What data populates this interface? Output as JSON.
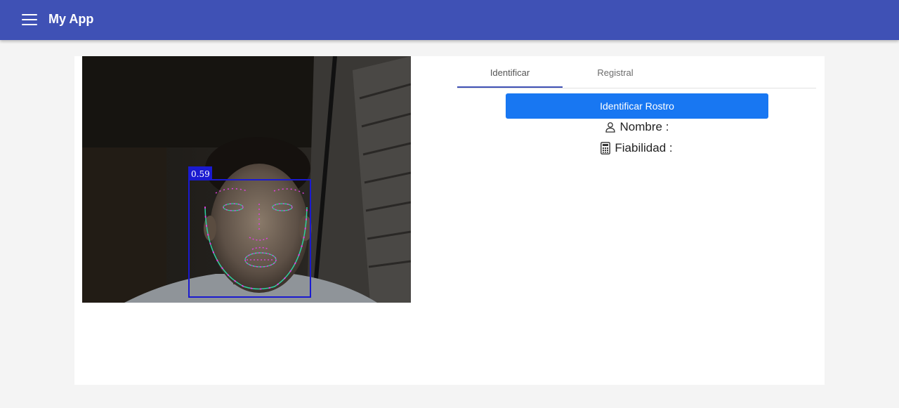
{
  "appbar": {
    "title": "My App",
    "menu_icon": "menu-icon"
  },
  "camera": {
    "detection_score": "0.59",
    "box_color": "#1a1ad0",
    "landmark_color": "#e040e0",
    "contour_color": "#2fd0a0"
  },
  "tabs": [
    {
      "label": "Identificar",
      "active": true
    },
    {
      "label": "Registral",
      "active": false
    }
  ],
  "identify_button": {
    "label": "Identificar Rostro"
  },
  "info": {
    "name_label": "Nombre :",
    "name_icon": "person-icon",
    "reliability_label": "Fiabilidad :",
    "reliability_icon": "calculator-icon"
  },
  "colors": {
    "appbar": "#3f51b5",
    "button": "#1877f2"
  }
}
